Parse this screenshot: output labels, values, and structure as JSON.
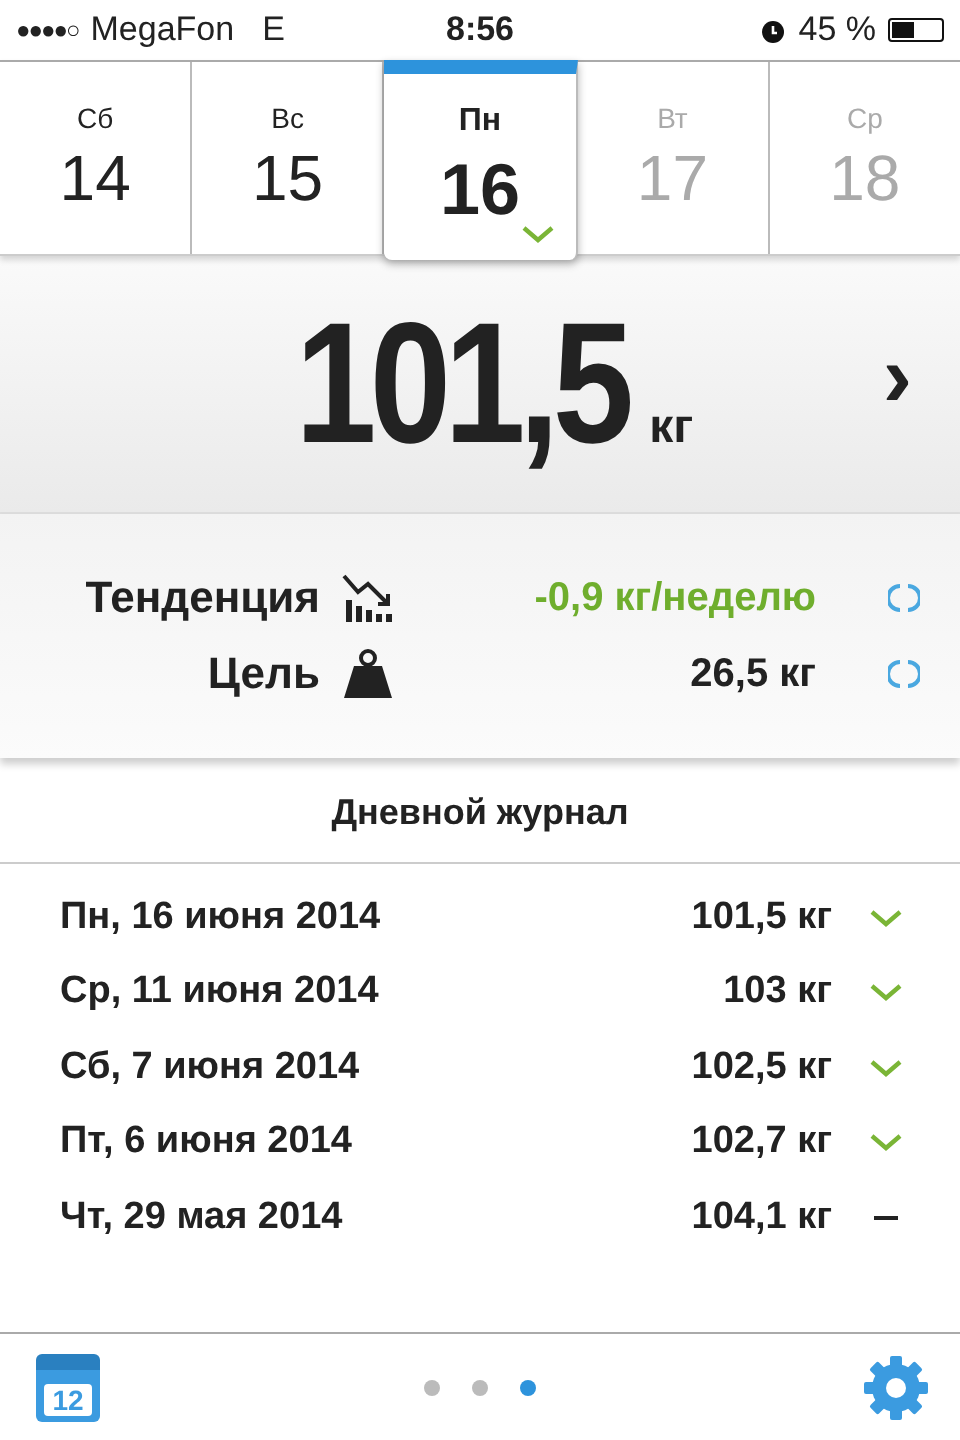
{
  "status_bar": {
    "signal": "●●●●○",
    "carrier": "MegaFon",
    "network": "E",
    "time": "8:56",
    "battery": "45 %"
  },
  "days": [
    {
      "weekday": "Сб",
      "day": "14",
      "selected": false,
      "disabled": false,
      "logged": false
    },
    {
      "weekday": "Вс",
      "day": "15",
      "selected": false,
      "disabled": false,
      "logged": false
    },
    {
      "weekday": "Пн",
      "day": "16",
      "selected": true,
      "disabled": false,
      "logged": true
    },
    {
      "weekday": "Вт",
      "day": "17",
      "selected": false,
      "disabled": true,
      "logged": false
    },
    {
      "weekday": "Ср",
      "day": "18",
      "selected": false,
      "disabled": true,
      "logged": false
    }
  ],
  "weight": {
    "value": "101,5",
    "unit": "кг",
    "arrow": "›"
  },
  "stats": [
    {
      "kind": "trend",
      "label": "Тенденция",
      "value": "-0,9 кг/неделю",
      "positive": true
    },
    {
      "kind": "goal",
      "label": "Цель",
      "value": "26,5 кг",
      "positive": false
    }
  ],
  "journal": {
    "title": "Дневной журнал",
    "entries": [
      {
        "date": "Пн, 16 июня 2014",
        "weight": "101,5 кг",
        "kind": "check"
      },
      {
        "date": "Ср, 11 июня 2014",
        "weight": "103 кг",
        "kind": "check"
      },
      {
        "date": "Сб, 7 июня 2014",
        "weight": "102,5 кг",
        "kind": "check"
      },
      {
        "date": "Пт, 6 июня 2014",
        "weight": "102,7 кг",
        "kind": "check"
      },
      {
        "date": "Чт, 29 мая 2014",
        "weight": "104,1 кг",
        "kind": "dash"
      }
    ]
  },
  "bottom_bar": {
    "calendar_day": "12",
    "pages": [
      {
        "selected": false
      },
      {
        "selected": false
      },
      {
        "selected": true
      }
    ]
  }
}
